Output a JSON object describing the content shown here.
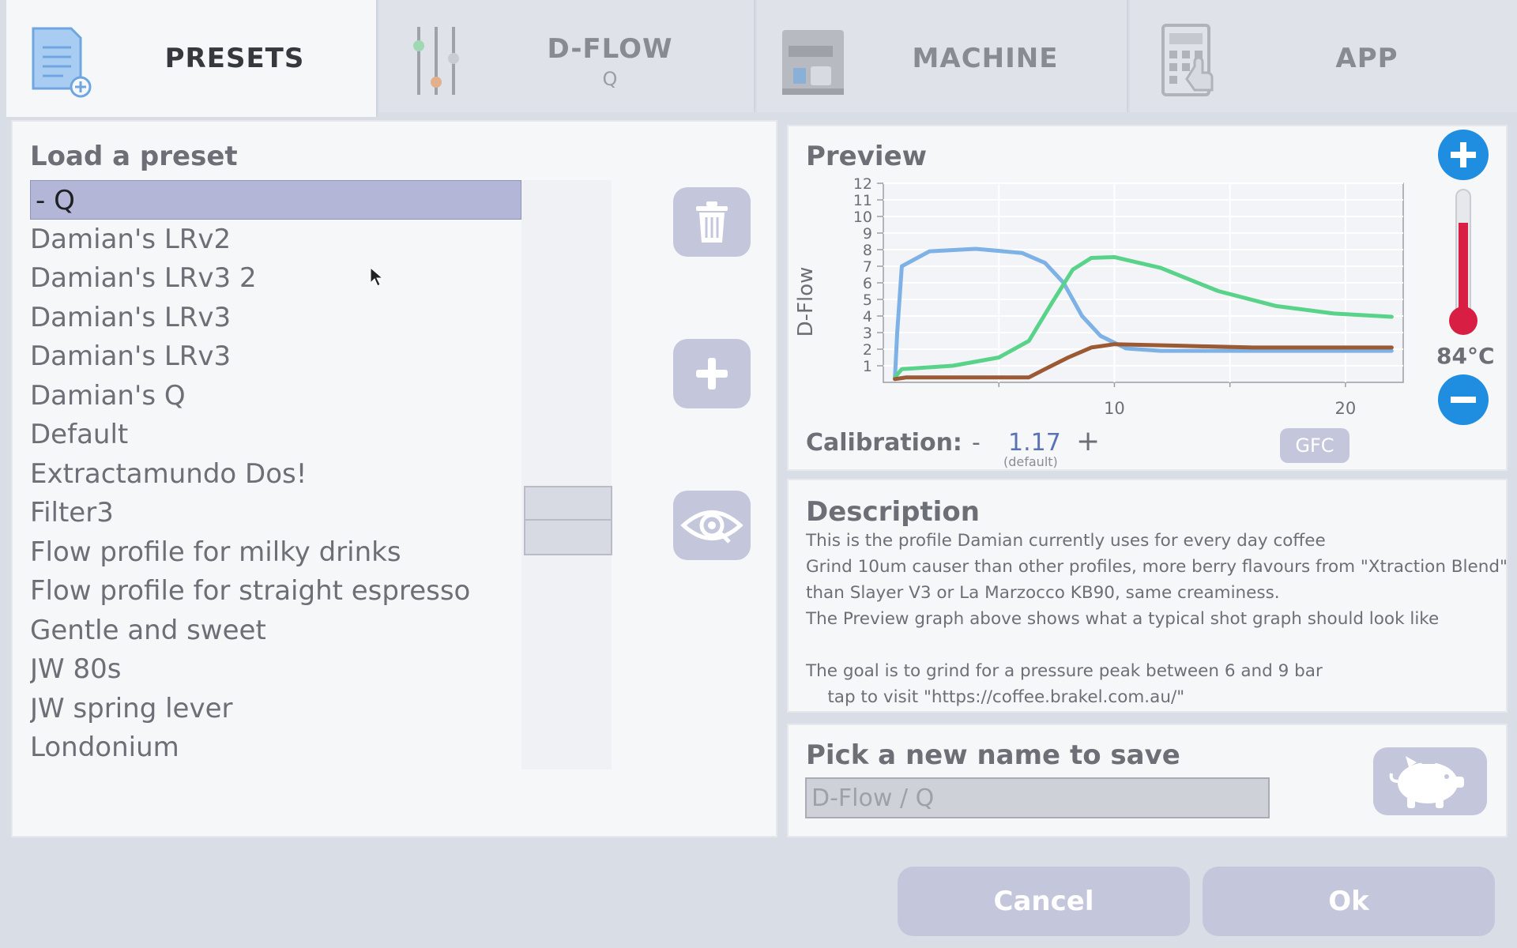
{
  "tabs": [
    {
      "label": "PRESETS",
      "sub": "",
      "icon": "presets-icon",
      "active": true
    },
    {
      "label": "D-FLOW",
      "sub": "Q",
      "icon": "sliders-icon",
      "active": false
    },
    {
      "label": "MACHINE",
      "sub": "",
      "icon": "espresso-machine-icon",
      "active": false
    },
    {
      "label": "APP",
      "sub": "",
      "icon": "app-settings-icon",
      "active": false
    }
  ],
  "presets": {
    "title": "Load a preset",
    "items": [
      " -  Q",
      "Damian's LRv2",
      "Damian's LRv3 2",
      "Damian's LRv3",
      "Damian's LRv3",
      "Damian's Q",
      "Default",
      "Extractamundo Dos!",
      "Filter3",
      "Flow profile for milky drinks",
      "Flow profile for straight espresso",
      "Gentle and sweet",
      "JW 80s",
      "JW spring lever",
      "Londonium"
    ],
    "selected_index": 0
  },
  "side_buttons": {
    "delete_icon": "trash-icon",
    "add_icon": "plus-icon",
    "view_icon": "eye-icon"
  },
  "preview": {
    "title": "Preview",
    "temperature": "84°C",
    "calibration_label": "Calibration:",
    "calibration_minus": "-",
    "calibration_value": "1.17",
    "calibration_note": "(default)",
    "calibration_plus": "+",
    "gfc_label": "GFC"
  },
  "chart_data": {
    "type": "line",
    "ylabel": "D-Flow",
    "xlabel": "",
    "xlim": [
      0,
      22.5
    ],
    "ylim": [
      0,
      12
    ],
    "x_ticks": [
      "10",
      "20"
    ],
    "y_ticks": [
      "1",
      "2",
      "3",
      "4",
      "5",
      "6",
      "7",
      "8",
      "9",
      "10",
      "11",
      "12"
    ],
    "grid": true,
    "series": [
      {
        "color": "#7eb2e6",
        "points": [
          [
            0.5,
            0.2
          ],
          [
            0.6,
            3
          ],
          [
            0.8,
            7
          ],
          [
            2,
            7.9
          ],
          [
            4,
            8.05
          ],
          [
            6,
            7.8
          ],
          [
            7,
            7.2
          ],
          [
            7.8,
            6
          ],
          [
            8.6,
            4
          ],
          [
            9.4,
            2.8
          ],
          [
            10.5,
            2.05
          ],
          [
            12,
            1.9
          ],
          [
            16,
            1.9
          ],
          [
            22,
            1.9
          ]
        ]
      },
      {
        "color": "#5ad38a",
        "points": [
          [
            0.5,
            0.3
          ],
          [
            0.8,
            0.8
          ],
          [
            3,
            1
          ],
          [
            5,
            1.5
          ],
          [
            6.3,
            2.5
          ],
          [
            7.3,
            4.8
          ],
          [
            8.2,
            6.8
          ],
          [
            9,
            7.5
          ],
          [
            10,
            7.55
          ],
          [
            12,
            6.9
          ],
          [
            14.5,
            5.5
          ],
          [
            17,
            4.6
          ],
          [
            19.5,
            4.15
          ],
          [
            22,
            3.95
          ]
        ]
      },
      {
        "color": "#9b5a34",
        "points": [
          [
            0.5,
            0.2
          ],
          [
            1,
            0.3
          ],
          [
            6.3,
            0.3
          ],
          [
            7,
            0.8
          ],
          [
            8,
            1.5
          ],
          [
            9,
            2.1
          ],
          [
            10,
            2.3
          ],
          [
            13,
            2.2
          ],
          [
            16,
            2.1
          ],
          [
            22,
            2.1
          ]
        ]
      }
    ]
  },
  "description": {
    "title": "Description",
    "lines": [
      "This is the profile Damian currently uses for every day coffee",
      "Grind 10um causer than other profiles, more berry flavours from \"Xtraction Blend\"",
      "than Slayer V3 or La Marzocco KB90, same creaminess.",
      "The Preview graph above shows what a typical shot graph should look like",
      "",
      "The goal is to grind for a pressure peak between 6 and 9 bar",
      "    tap to visit \"https://coffee.brakel.com.au/\""
    ]
  },
  "save": {
    "title": "Pick a new name to save",
    "value": "D-Flow / Q",
    "icon": "piggy-bank-icon"
  },
  "footer": {
    "cancel": "Cancel",
    "ok": "Ok"
  }
}
